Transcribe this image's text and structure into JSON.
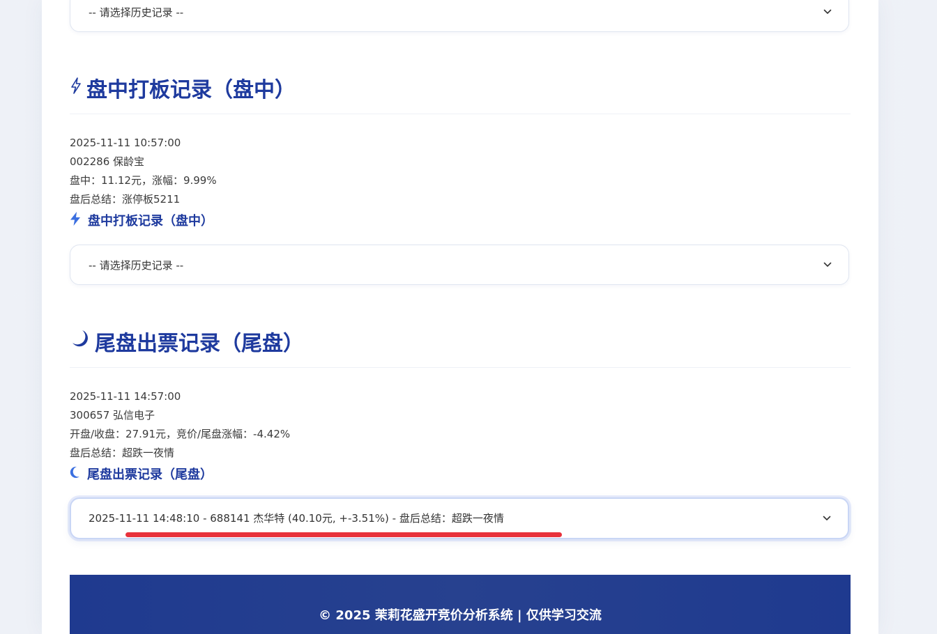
{
  "top_select": {
    "value": "-- 请选择历史记录 --",
    "chevron_icon": "chevron-down-icon"
  },
  "intraday": {
    "title_icon": "lightning-icon",
    "title": "盘中打板记录（盘中）",
    "record": {
      "time": "2025-11-11 10:57:00",
      "stock": "002286 保龄宝",
      "price_line": "盘中：11.12元，涨幅：9.99%",
      "summary": "盘后总结：涨停板5211"
    },
    "subtitle_icon": "lightning-icon",
    "subtitle": "盘中打板记录（盘中）",
    "select_value": "-- 请选择历史记录 --"
  },
  "closing": {
    "title_icon": "moon-icon",
    "title": "尾盘出票记录（尾盘）",
    "record": {
      "time": "2025-11-11 14:57:00",
      "stock": "300657 弘信电子",
      "price_line": "开盘/收盘：27.91元，竞价/尾盘涨幅：-4.42%",
      "summary": "盘后总结：超跌一夜情"
    },
    "subtitle_icon": "moon-icon",
    "subtitle": "尾盘出票记录（尾盘）",
    "select_value": "2025-11-11 14:48:10 - 688141 杰华特 (40.10元, +-3.51%) - 盘后总结：超跌一夜情"
  },
  "footer": {
    "text": "© 2025 茉莉花盛开竞价分析系统 | 仅供学习交流"
  },
  "colors": {
    "title_blue": "#1e3a9e",
    "icon_blue": "#3b6fe0",
    "footer_bg": "#1f3a8f",
    "highlight_red": "#e8323c"
  }
}
